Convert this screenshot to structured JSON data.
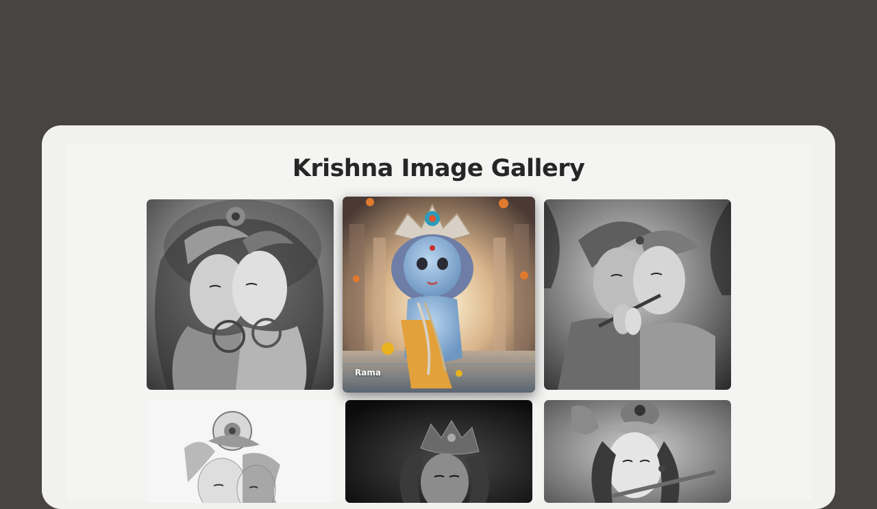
{
  "page": {
    "title": "Krishna Image Gallery"
  },
  "gallery": {
    "items": [
      {
        "icon": "radha-krishna-sketch-image",
        "style": "grayscale"
      },
      {
        "icon": "bal-krishna-temple-image",
        "style": "color",
        "caption": "Rama",
        "active": true
      },
      {
        "icon": "radha-krishna-flute-image",
        "style": "grayscale"
      },
      {
        "icon": "krishna-peacock-crown-sketch-image",
        "style": "grayscale"
      },
      {
        "icon": "krishna-dark-crown-image",
        "style": "grayscale"
      },
      {
        "icon": "krishna-flute-portrait-image",
        "style": "grayscale"
      }
    ]
  },
  "colors": {
    "background": "#484443",
    "panel": "#f1f1f0",
    "title": "#262626",
    "krishna_skin": "#8ab4d8",
    "dhoti": "#e2a13a"
  }
}
